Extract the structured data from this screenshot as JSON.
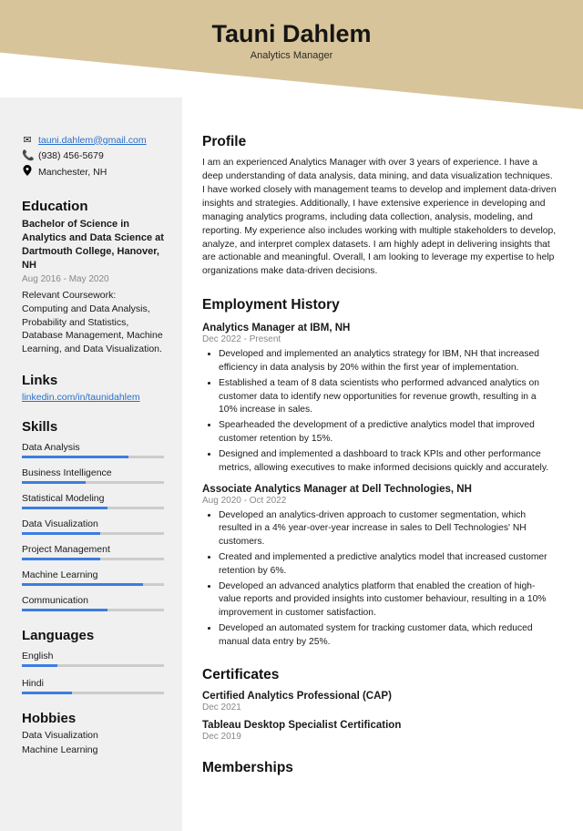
{
  "header": {
    "name": "Tauni Dahlem",
    "title": "Analytics Manager"
  },
  "contact": {
    "email": "tauni.dahlem@gmail.com",
    "phone": "(938) 456-5679",
    "location": "Manchester, NH"
  },
  "education": {
    "heading": "Education",
    "degree": "Bachelor of Science in Analytics and Data Science at Dartmouth College, Hanover, NH",
    "dates": "Aug 2016 - May 2020",
    "desc": "Relevant Coursework: Computing and Data Analysis, Probability and Statistics, Database Management, Machine Learning, and Data Visualization."
  },
  "links": {
    "heading": "Links",
    "items": [
      {
        "label": "linkedin.com/in/taunidahlem"
      }
    ]
  },
  "skills": {
    "heading": "Skills",
    "items": [
      {
        "name": "Data Analysis",
        "level": 75
      },
      {
        "name": "Business Intelligence",
        "level": 45
      },
      {
        "name": "Statistical Modeling",
        "level": 60
      },
      {
        "name": "Data Visualization",
        "level": 55
      },
      {
        "name": "Project Management",
        "level": 55
      },
      {
        "name": "Machine Learning",
        "level": 85
      },
      {
        "name": "Communication",
        "level": 60
      }
    ]
  },
  "languages": {
    "heading": "Languages",
    "items": [
      {
        "name": "English",
        "level": 25
      },
      {
        "name": "Hindi",
        "level": 35
      }
    ]
  },
  "hobbies": {
    "heading": "Hobbies",
    "items": [
      "Data Visualization",
      "Machine Learning"
    ]
  },
  "profile": {
    "heading": "Profile",
    "text": "I am an experienced Analytics Manager with over 3 years of experience. I have a deep understanding of data analysis, data mining, and data visualization techniques. I have worked closely with management teams to develop and implement data-driven insights and strategies. Additionally, I have extensive experience in developing and managing analytics programs, including data collection, analysis, modeling, and reporting. My experience also includes working with multiple stakeholders to develop, analyze, and interpret complex datasets. I am highly adept in delivering insights that are actionable and meaningful. Overall, I am looking to leverage my expertise to help organizations make data-driven decisions."
  },
  "employment": {
    "heading": "Employment History",
    "jobs": [
      {
        "title": "Analytics Manager at IBM, NH",
        "dates": "Dec 2022 - Present",
        "bullets": [
          "Developed and implemented an analytics strategy for IBM, NH that increased efficiency in data analysis by 20% within the first year of implementation.",
          "Established a team of 8 data scientists who performed advanced analytics on customer data to identify new opportunities for revenue growth, resulting in a 10% increase in sales.",
          "Spearheaded the development of a predictive analytics model that improved customer retention by 15%.",
          "Designed and implemented a dashboard to track KPIs and other performance metrics, allowing executives to make informed decisions quickly and accurately."
        ]
      },
      {
        "title": "Associate Analytics Manager at Dell Technologies, NH",
        "dates": "Aug 2020 - Oct 2022",
        "bullets": [
          "Developed an analytics-driven approach to customer segmentation, which resulted in a 4% year-over-year increase in sales to Dell Technologies' NH customers.",
          "Created and implemented a predictive analytics model that increased customer retention by 6%.",
          "Developed an advanced analytics platform that enabled the creation of high-value reports and provided insights into customer behaviour, resulting in a 10% improvement in customer satisfaction.",
          "Developed an automated system for tracking customer data, which reduced manual data entry by 25%."
        ]
      }
    ]
  },
  "certificates": {
    "heading": "Certificates",
    "items": [
      {
        "title": "Certified Analytics Professional (CAP)",
        "date": "Dec 2021"
      },
      {
        "title": "Tableau Desktop Specialist Certification",
        "date": "Dec 2019"
      }
    ]
  },
  "memberships": {
    "heading": "Memberships"
  }
}
